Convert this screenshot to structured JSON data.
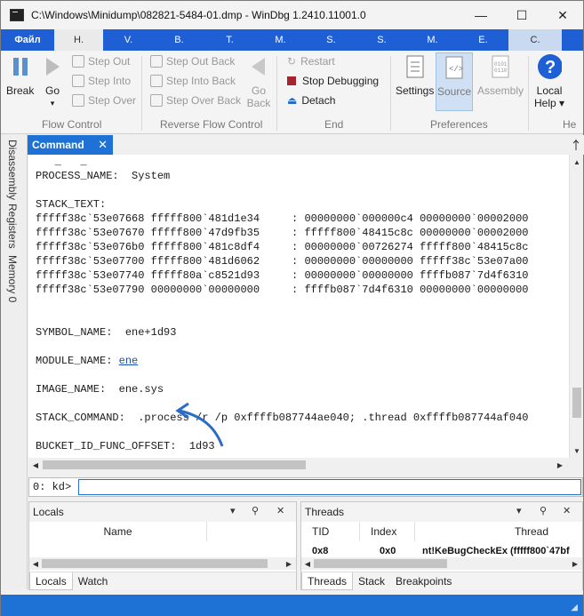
{
  "window": {
    "title": "C:\\Windows\\Minidump\\082821-5484-01.dmp - WinDbg 1.2410.11001.0",
    "min_label": "—",
    "max_label": "☐",
    "close_label": "✕"
  },
  "ribbon_tabs": {
    "file": "Файл",
    "t1": "Н.",
    "t2": "V.",
    "t3": "B.",
    "t4": "T.",
    "t5": "M.",
    "t6": "S.",
    "t7": "S.",
    "t8": "M.",
    "t9": "E.",
    "t10": "C."
  },
  "ribbon": {
    "break": "Break",
    "go": "Go",
    "go_arrow": "▾",
    "step_out": "Step Out",
    "step_into": "Step Into",
    "step_over": "Step Over",
    "step_out_back": "Step Out Back",
    "step_into_back": "Step Into Back",
    "step_over_back": "Step Over Back",
    "go_back_1": "Go",
    "go_back_2": "Back",
    "restart": "Restart",
    "stop_debugging": "Stop Debugging",
    "detach": "Detach",
    "settings": "Settings",
    "source": "Source",
    "assembly": "Assembly",
    "local_help_1": "Local",
    "local_help_2": "Help ▾",
    "group_flow": "Flow Control",
    "group_reverse": "Reverse Flow Control",
    "group_end": "End",
    "group_prefs": "Preferences",
    "group_help": "He"
  },
  "side_tabs": {
    "disassembly": "Disassembly",
    "registers": "Registers",
    "memory": "Memory 0"
  },
  "command_tab": {
    "label": "Command",
    "close": "✕"
  },
  "output": {
    "lines": [
      "   _   _",
      "PROCESS_NAME:  System",
      "",
      "STACK_TEXT:",
      "fffff38c`53e07668 fffff800`481d1e34     : 00000000`000000c4 00000000`00002000",
      "fffff38c`53e07670 fffff800`47d9fb35     : fffff800`48415c8c 00000000`00002000",
      "fffff38c`53e076b0 fffff800`481c8df4     : 00000000`00726274 fffff800`48415c8c",
      "fffff38c`53e07700 fffff800`481d6062     : 00000000`00000000 fffff38c`53e07a00",
      "fffff38c`53e07740 fffff80a`c8521d93     : 00000000`00000000 ffffb087`7d4f6310",
      "fffff38c`53e07790 00000000`00000000     : ffffb087`7d4f6310 00000000`00000000",
      "",
      "",
      "SYMBOL_NAME:  ene+1d93",
      "",
      "MODULE_NAME: ",
      "",
      "IMAGE_NAME:  ene.sys",
      "",
      "STACK_COMMAND:  .process /r /p 0xffffb087744ae040; .thread 0xffffb087744af040",
      "",
      "BUCKET_ID_FUNC_OFFSET:  1d93"
    ],
    "module_link": "ene"
  },
  "kd": {
    "prompt": "0: kd>",
    "value": ""
  },
  "locals": {
    "title": "Locals",
    "col_name": "Name",
    "tab_locals": "Locals",
    "tab_watch": "Watch"
  },
  "threads": {
    "title": "Threads",
    "col_tid": "TID",
    "col_index": "Index",
    "col_thread": "Thread",
    "row_tid": "0x8",
    "row_index": "0x0",
    "row_thread": "nt!KeBugCheckEx (fffff800`47bf",
    "tab_threads": "Threads",
    "tab_stack": "Stack",
    "tab_breakpoints": "Breakpoints"
  },
  "pane_controls": {
    "dropdown": "▾",
    "pin": "⚲",
    "close": "✕"
  },
  "colors": {
    "accent": "#1e72d6",
    "ribbon_tabs_bg": "#1e5fd6",
    "annotation": "#2b6cc4"
  }
}
